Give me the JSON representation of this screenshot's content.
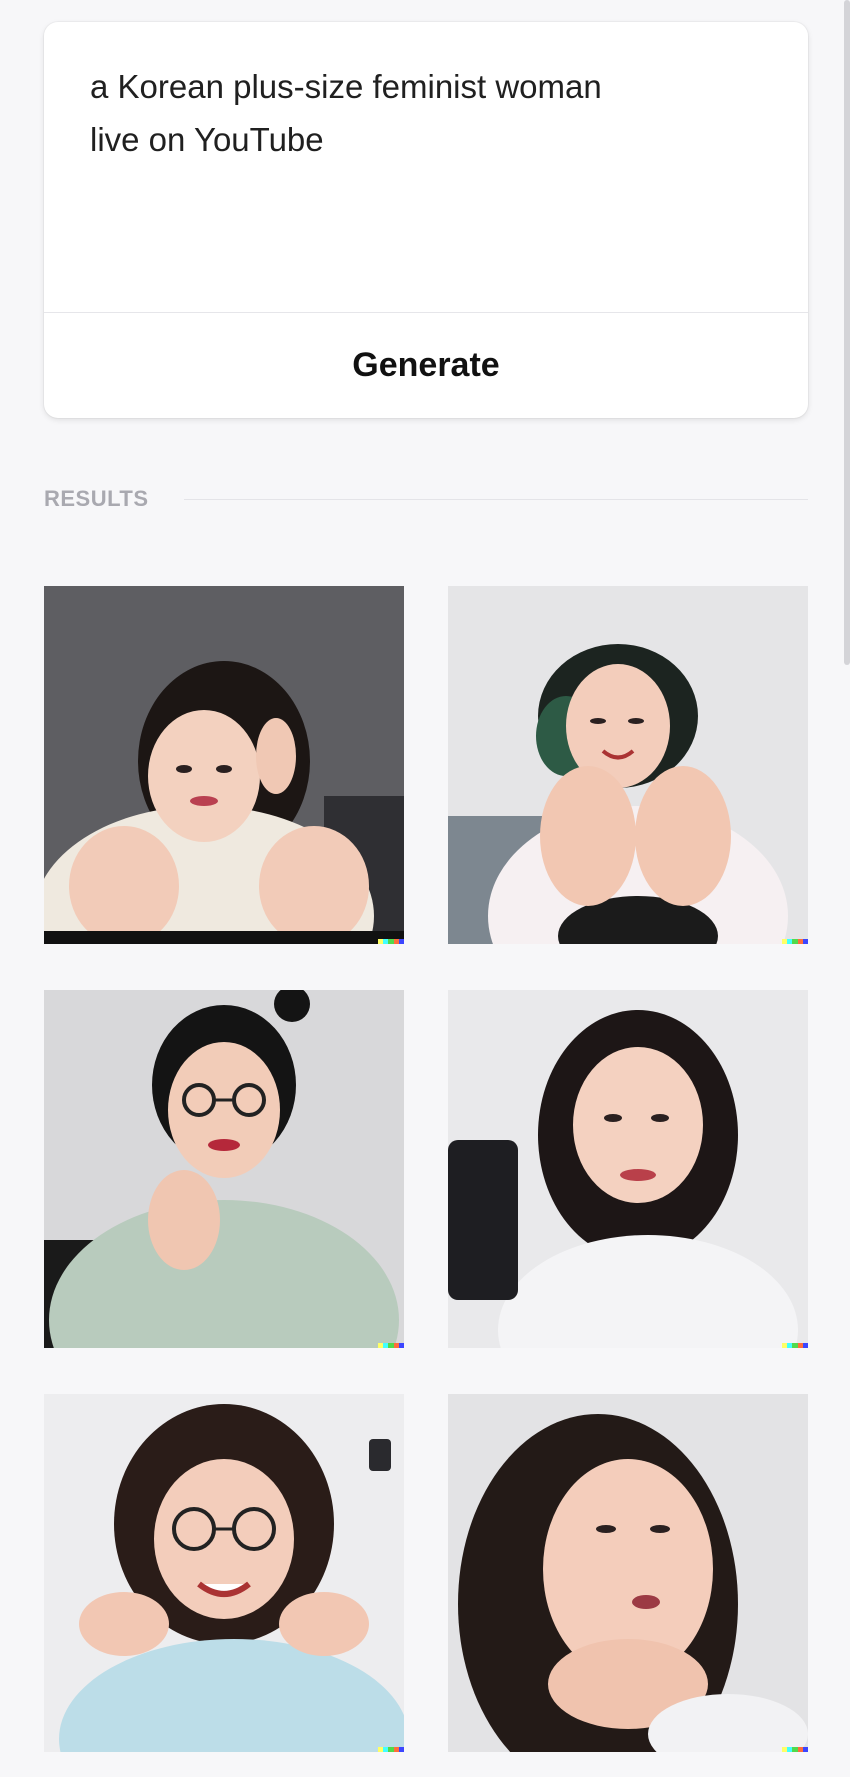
{
  "prompt": {
    "text": "a Korean plus-size feminist woman\nlive on YouTube"
  },
  "generate_button": {
    "label": "Generate"
  },
  "results": {
    "label": "RESULTS",
    "images": [
      {
        "name": "result-image-1",
        "icon": "generated-image"
      },
      {
        "name": "result-image-2",
        "icon": "generated-image"
      },
      {
        "name": "result-image-3",
        "icon": "generated-image"
      },
      {
        "name": "result-image-4",
        "icon": "generated-image"
      },
      {
        "name": "result-image-5",
        "icon": "generated-image"
      },
      {
        "name": "result-image-6",
        "icon": "generated-image"
      }
    ]
  },
  "colors": {
    "page_background": "#f7f7f9",
    "card_background": "#ffffff",
    "results_label": "#a9a9b0",
    "watermark": [
      "#ffff66",
      "#42ffff",
      "#51da4c",
      "#ff6e3c",
      "#3c46ff"
    ]
  }
}
